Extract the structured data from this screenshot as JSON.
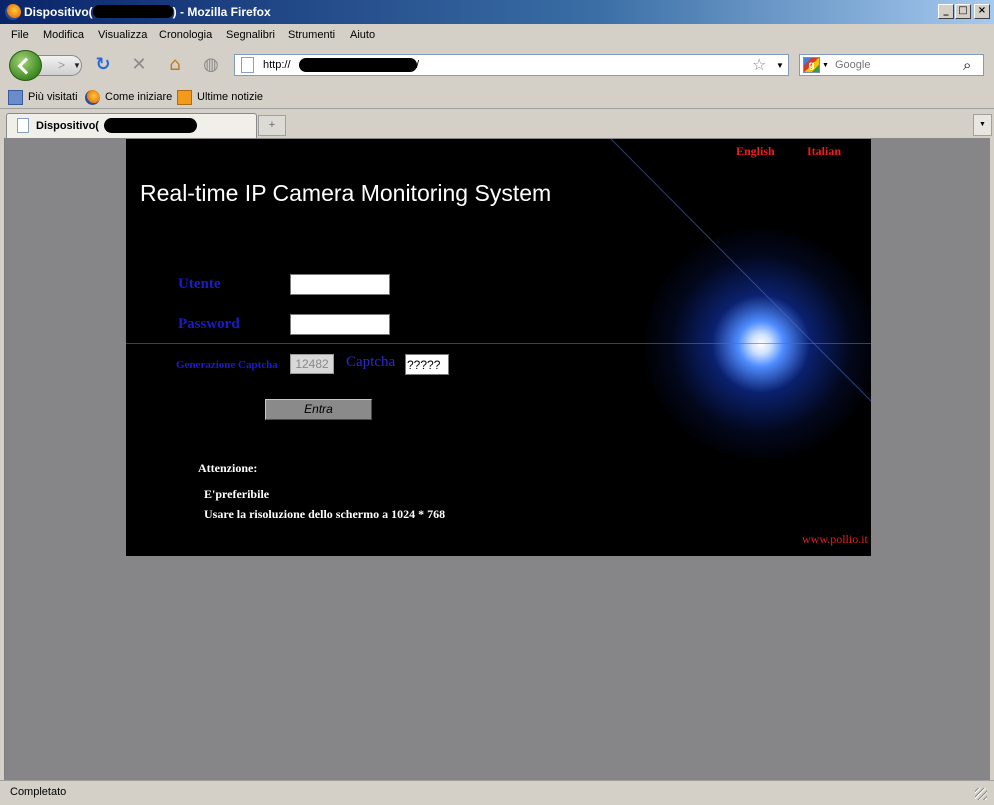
{
  "window": {
    "title_prefix": "Dispositivo(",
    "title_suffix": ") - Mozilla Firefox",
    "minimize": "_",
    "maximize": "□",
    "close": "×"
  },
  "menu": [
    "File",
    "Modifica",
    "Visualizza",
    "Cronologia",
    "Segnalibri",
    "Strumenti",
    "Aiuto"
  ],
  "nav": {
    "url_prefix": "http://",
    "url_suffix": "/",
    "search_placeholder": "Google",
    "icons": [
      "back-icon",
      "forward-icon",
      "reload-icon",
      "stop-icon",
      "home-icon",
      "history-icon"
    ]
  },
  "bookmarks": [
    "Più visitati",
    "Come iniziare",
    "Ultime notizie"
  ],
  "tab": {
    "label": "Dispositivo(",
    "new_tab": "+"
  },
  "page": {
    "lang_english": "English",
    "lang_italian": "Italian",
    "heading": "Real-time IP Camera Monitoring System",
    "user_label": "Utente",
    "password_label": "Password",
    "captcha_gen_label": "Generazione Captcha",
    "captcha_gen_value": "12482",
    "captcha_label": "Captcha",
    "captcha_value": "?????",
    "login_button": "Entra",
    "attention": "Attenzione:",
    "note_1": "E'preferibile",
    "note_2": "Usare la risoluzione dello schermo a 1024 * 768",
    "site": "www.pollio.it"
  },
  "status": {
    "text": "Completato"
  }
}
